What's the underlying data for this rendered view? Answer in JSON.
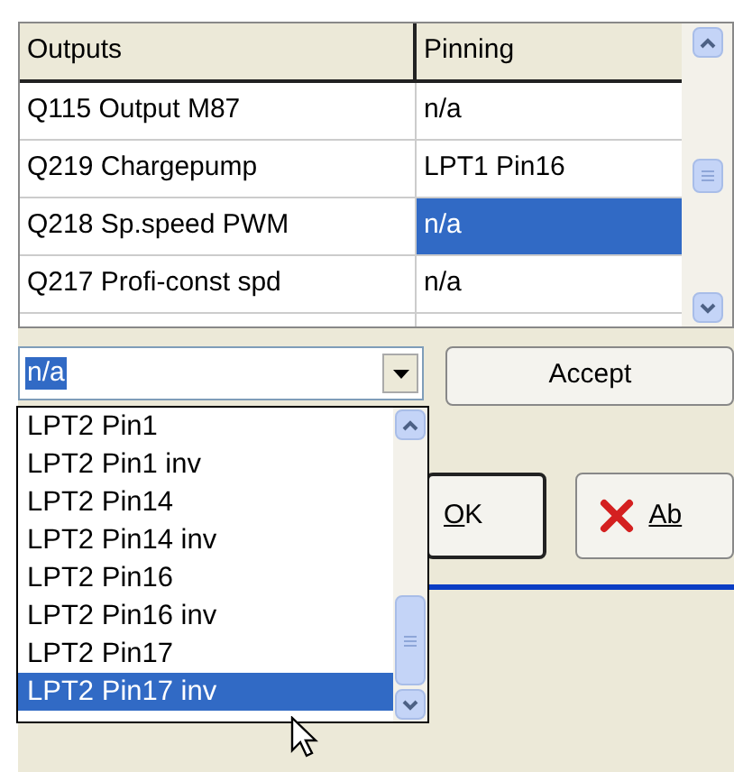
{
  "table": {
    "columns": [
      "Outputs",
      "Pinning"
    ],
    "rows": [
      {
        "output": "Q115 Output M87",
        "pinning": "n/a",
        "selected": false
      },
      {
        "output": "Q219 Chargepump",
        "pinning": "LPT1 Pin16",
        "selected": false
      },
      {
        "output": "Q218 Sp.speed PWM",
        "pinning": "n/a",
        "selected": true
      },
      {
        "output": "Q217 Profi-const spd",
        "pinning": "n/a",
        "selected": false
      }
    ]
  },
  "combo": {
    "value": "n/a"
  },
  "dropdown": [
    {
      "label": "LPT2 Pin1",
      "selected": false
    },
    {
      "label": "LPT2 Pin1 inv",
      "selected": false
    },
    {
      "label": "LPT2 Pin14",
      "selected": false
    },
    {
      "label": "LPT2 Pin14 inv",
      "selected": false
    },
    {
      "label": "LPT2 Pin16",
      "selected": false
    },
    {
      "label": "LPT2 Pin16 inv",
      "selected": false
    },
    {
      "label": "LPT2 Pin17",
      "selected": false
    },
    {
      "label": "LPT2 Pin17 inv",
      "selected": true
    }
  ],
  "buttons": {
    "accept": "Accept",
    "ok": "OK",
    "abort": "Ab"
  }
}
